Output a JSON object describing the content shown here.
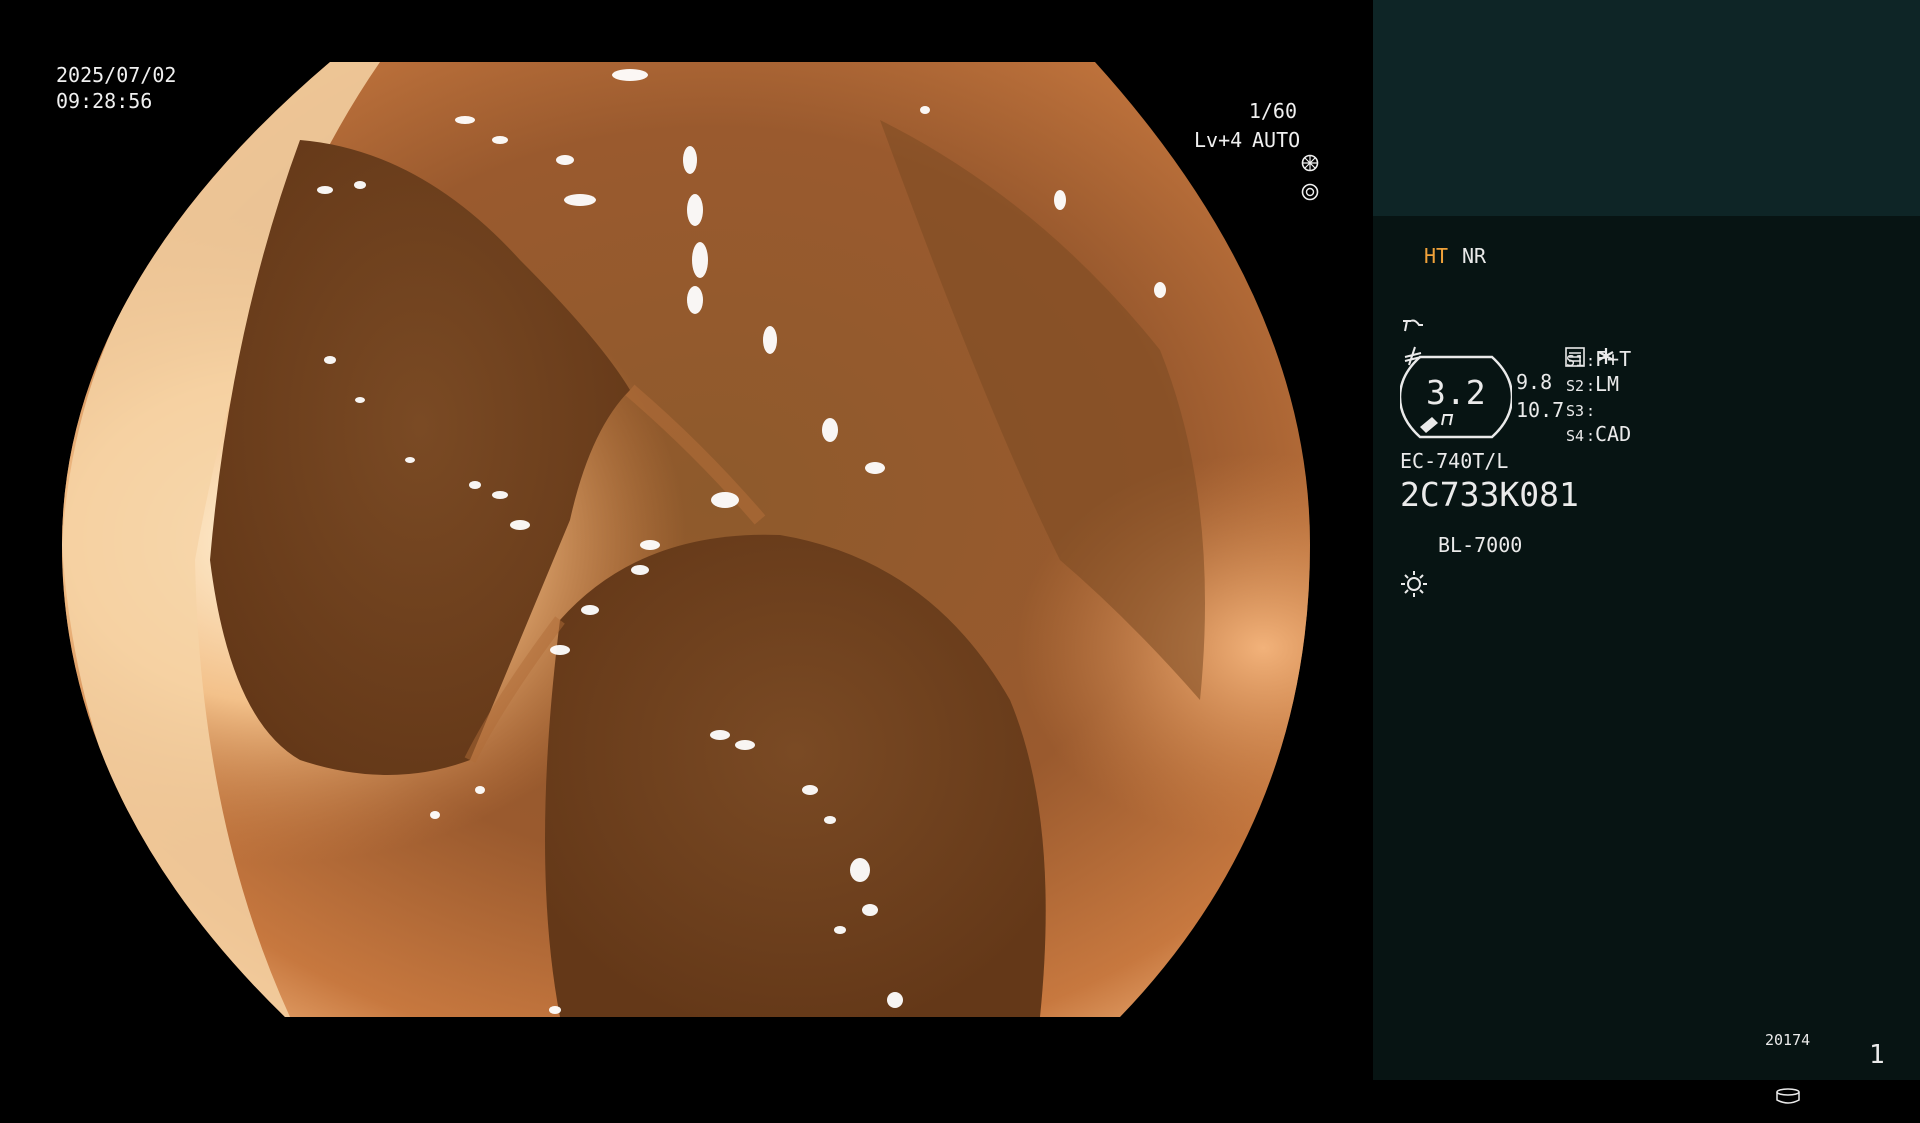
{
  "overlay": {
    "date": "2025/07/02",
    "time": "09:28:56",
    "shutter": "1/60",
    "level": "Lv+4",
    "iris_mode": "AUTO"
  },
  "panel": {
    "mode_ht": "HT",
    "mode_nr": "NR",
    "zoom_value": "3.2",
    "num_a": "9.8",
    "num_b": "10.7",
    "switches": [
      {
        "key": "S1",
        "value": "F+T"
      },
      {
        "key": "S2",
        "value": "LM"
      },
      {
        "key": "S3",
        "value": ""
      },
      {
        "key": "S4",
        "value": "CAD"
      }
    ],
    "scope_model": "EC-740T/L",
    "scope_serial": "2C733K081",
    "light_source": "BL-7000",
    "storage_count": "20174",
    "page_index": "1"
  },
  "colors": {
    "panel_bg": "#071413",
    "panel_top": "#0e2526",
    "ht_accent": "#f0a23a",
    "tissue": "#8a4f26"
  },
  "icons": [
    "shutter-icon",
    "iris-icon",
    "enhance-icon",
    "filter-icon",
    "menu-icon",
    "asterisk-icon",
    "light-icon",
    "storage-icon"
  ]
}
